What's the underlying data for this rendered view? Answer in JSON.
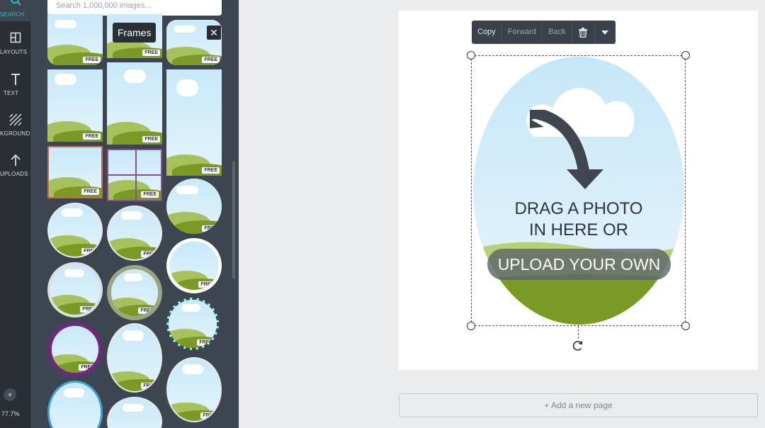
{
  "nav": {
    "items": [
      {
        "label": "SEARCH",
        "icon": "search-icon"
      },
      {
        "label": "LAYOUTS",
        "icon": "layouts-icon"
      },
      {
        "label": "TEXT",
        "icon": "text-icon"
      },
      {
        "label": "KGROUND",
        "icon": "background-icon"
      },
      {
        "label": "UPLOADS",
        "icon": "upload-icon"
      }
    ],
    "plus": "+",
    "zoom": "77.7%"
  },
  "panel": {
    "search_placeholder": "Search 1,000,000 images...",
    "tooltip": "Frames",
    "close": "✕",
    "badge": "FREE"
  },
  "toolbar": {
    "copy": "Copy",
    "forward": "Forward",
    "back": "Back"
  },
  "frame": {
    "line1": "DRAG A PHOTO",
    "line2": "IN HERE OR",
    "upload": "UPLOAD YOUR OWN"
  },
  "add_page": "+ Add a new page",
  "colors": {
    "accent": "#20c4cb",
    "rail": "#2a2f35",
    "panel": "#3d4550",
    "grass": "#7a9a25",
    "sky": "#c8e9f9"
  }
}
